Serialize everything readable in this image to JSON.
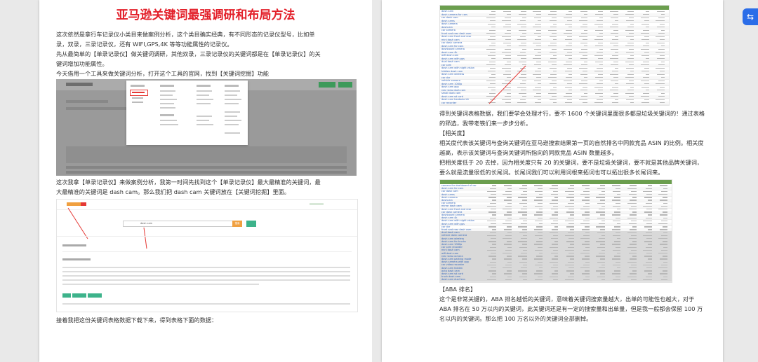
{
  "left_page": {
    "title": "亚马逊关键词最强调研和布局方法",
    "para1": [
      "这次依然是拿行车记录仪小类目来做案例分析，这个类目确实经典，有不同形态的记录仪型号，比如单",
      "录，双录，三录记录仪，还有 WIFI,GPS,4K 等等功能属性的记录仪。",
      "先从最简单的【单录记录仪】做关键词调研，其他双录，三录记录仪的关键词都是在【单录记录仪】的关",
      "键词增加功能属性。",
      "今天借用一个工具来做关键词分析，打开这个工具的官网，找到【关键词挖掘】功能"
    ],
    "para2": [
      "这次我拿【单录记录仪】来做案例分析，我第一时间先找到这个【单录记录仪】最大最精准的关键词，最",
      "大最精准的关键词是 dash cam。那么我们把 dash cam 关键词放在【关键词挖掘】里面。"
    ],
    "para3": "接着我把这份关键词表格数据下载下来，得到表格下面的数据：",
    "shot2_search_value": "dash cam",
    "shot2_search_button": "搜索"
  },
  "right_page": {
    "para1": [
      "得到关键词表格数据，我们要学会处理才行，要不 1600 个关键词里面很多都是垃圾关键词的！通过表格",
      "的筛选，我带老铁们来一步步分析。"
    ],
    "heading_relevance": "【相关度】",
    "para2": [
      "相关度代表该关键词与查询关键词在亚马逊搜索结果第一页的自然排名中同款竞品 ASIN 的比例。相关度",
      "越高，表示该关键词与查询关键词所指向的同款竞品 ASIN 数量越多。",
      "把相关度低于 20 去掉，因为相关度只有 20 的关键词，要不是垃圾关键词，要不就是其他品牌关键词，",
      "要么就是流量很低的长尾词。长尾词我们可以利用词根来拓词也可以拓出很多长尾词来。"
    ],
    "heading_aba": "【ABA 排名】",
    "para3": [
      "这个是非常关键的，ABA 排名越低的关键词，意味着关键词搜索量越大，出单的可能性也越大，对于",
      "ABA 排名在 50 万以内的关键词，此关键词还是有一定的搜索量和出单量，但是我一般都会保留 100 万",
      "名以内的关键词。那么把 100 万名以外的关键词全部删掉。"
    ],
    "table1_keywords": [
      "dash cam",
      "dash camera for cars",
      "car dash cam",
      "dash cams",
      "dash camera",
      "dashcam",
      "car camera",
      "front and rear dash cam",
      "dash cam front and rear",
      "mini dash cam",
      "car dash camera",
      "dash cam for cars",
      "dashboard camera",
      "dash cam 4k",
      "wifi dash cam",
      "dash cam with gps",
      "dual dash cam",
      "car cam",
      "dash cam with night vision",
      "hidden dash cam",
      "dash cam wireless",
      "car dvr",
      "vehicle camera",
      "dash cam 1080p",
      "dash cam app",
      "rear view dash cam",
      "small dash cam",
      "dash cam sd card",
      "dash cam hardwire kit",
      "car recorder"
    ],
    "table2_keywords": [
      "camera for dashboard of car",
      "dash cam for cars",
      "car dash cam",
      "dash cams",
      "dash camera",
      "dashcam",
      "car camera",
      "mirror dash cam",
      "dash cam front and rear",
      "car dash camera",
      "dashboard camera",
      "dash cam 4k",
      "dash cam with night vision",
      "dash cam with gps",
      "car dvr",
      "front and rear dash cam",
      "dual dash cam",
      "vehicle dash camera",
      "dash cam wireless",
      "dash cam for trucks",
      "dash cam 1080p",
      "car cam recorder",
      "mini dash cam",
      "wifi dash cam",
      "rear view camera",
      "dash cam parking mode",
      "dash camera with app",
      "car video recorder",
      "dash cam hidden",
      "auto dash cam",
      "dash cam sd card",
      "truck dash cam",
      "dash cam dual lens"
    ]
  }
}
